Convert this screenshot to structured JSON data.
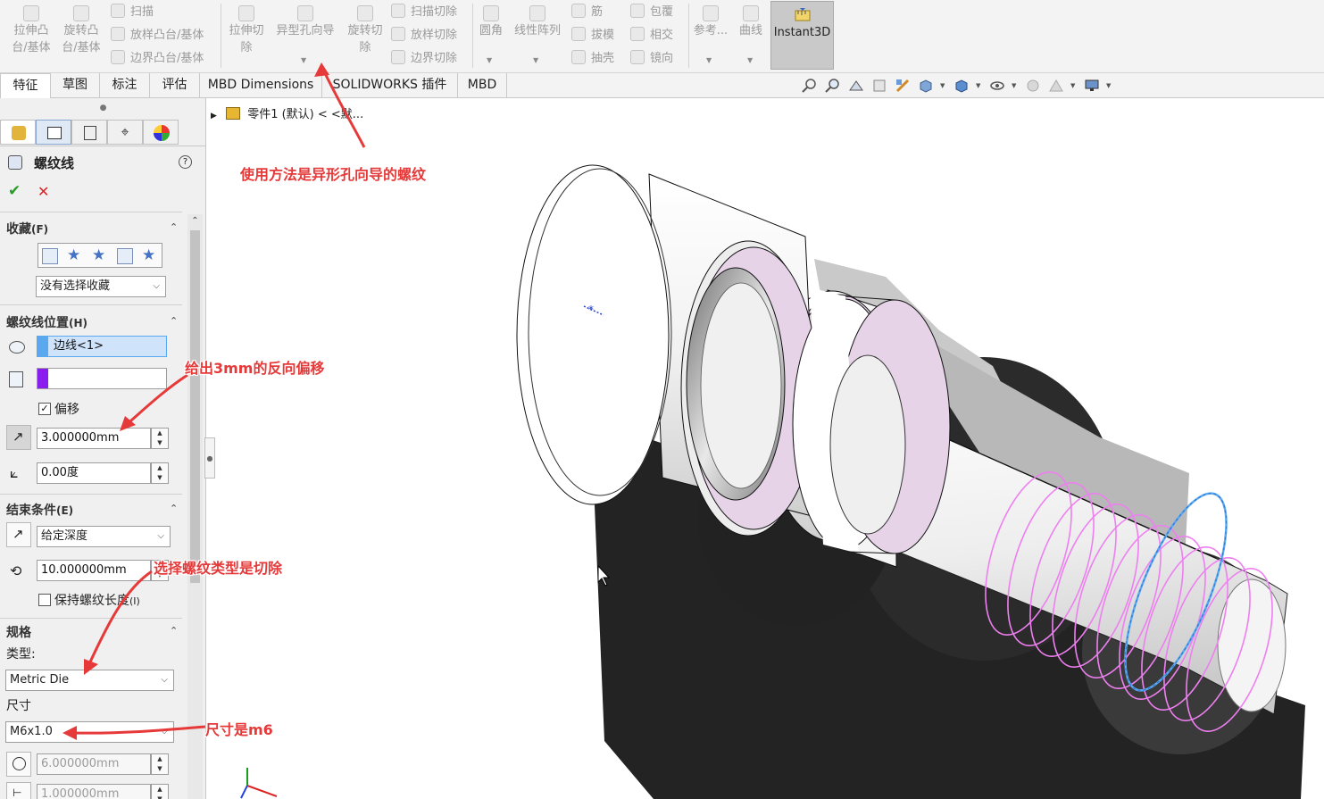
{
  "ribbon": {
    "extrude_boss": "拉伸凸\n台/基体",
    "revolve_boss": "旋转凸\n台/基体",
    "sweep": "扫描",
    "loft_boss": "放样凸台/基体",
    "boundary_boss": "边界凸台/基体",
    "extrude_cut": "拉伸切\n除",
    "hole_wizard": "异型孔向导",
    "revolve_cut": "旋转切\n除",
    "swept_cut": "扫描切除",
    "lofted_cut": "放样切除",
    "boundary_cut": "边界切除",
    "fillet": "圆角",
    "linear_pattern": "线性阵列",
    "rib": "筋",
    "draft": "拔模",
    "shell": "抽壳",
    "wrap": "包覆",
    "intersect": "相交",
    "mirror": "镜向",
    "reference": "参考...",
    "curves": "曲线",
    "instant3d": "Instant3D"
  },
  "tabs": [
    "特征",
    "草图",
    "标注",
    "评估",
    "MBD Dimensions",
    "SOLIDWORKS 插件",
    "MBD"
  ],
  "tree": {
    "part_label": "零件1 (默认) < <默..."
  },
  "panel": {
    "title": "螺纹线",
    "help": "?",
    "favorites": {
      "title": "收藏",
      "hotkey": "(F)",
      "select_value": "没有选择收藏"
    },
    "position": {
      "title": "螺纹线位置",
      "hotkey": "(H)",
      "edge_value": "边线<1>",
      "face_value": "",
      "offset_label": "偏移",
      "offset_checked": true,
      "offset_value": "3.000000mm",
      "angle_value": "0.00度"
    },
    "end_condition": {
      "title": "结束条件",
      "hotkey": "(E)",
      "select_value": "给定深度",
      "depth_value": "10.000000mm",
      "keep_length_label": "保持螺纹长度",
      "keep_length_hotkey": "(I)",
      "keep_length_checked": false
    },
    "spec": {
      "title": "规格",
      "type_label": "类型:",
      "type_value": "Metric Die",
      "size_label": "尺寸",
      "size_value": "M6x1.0",
      "diameter_value": "6.000000mm",
      "pitch_value": "1.000000mm"
    }
  },
  "annotations": {
    "hole_wizard_note": "使用方法是异形孔向导的螺纹",
    "offset_note": "给出3mm的反向偏移",
    "type_note": "选择螺纹类型是切除",
    "size_note": "尺寸是m6"
  },
  "colors": {
    "accent_red": "#e63a3a",
    "selection_blue": "#5aa9f0",
    "selection_purple": "#8b1cf0",
    "helix_pink": "#ee7ff0",
    "face_pink": "#e2d0e4"
  }
}
